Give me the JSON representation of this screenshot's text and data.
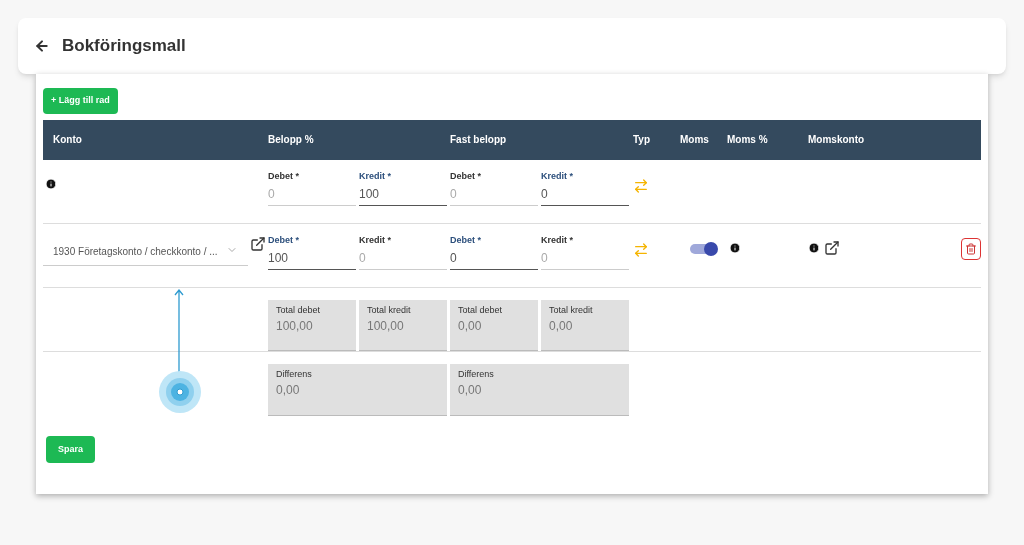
{
  "header": {
    "title": "Bokföringsmall"
  },
  "add_button": "+ Lägg till rad",
  "columns": [
    "Konto",
    "Belopp %",
    "Fast belopp",
    "Typ",
    "Moms",
    "Moms %",
    "Momskonto"
  ],
  "rows": [
    {
      "account": null,
      "belopp": [
        {
          "label": "Debet *",
          "value": "0",
          "active": false
        },
        {
          "label": "Kredit *",
          "value": "100",
          "active": true
        }
      ],
      "fast": [
        {
          "label": "Debet *",
          "value": "0",
          "active": false
        },
        {
          "label": "Kredit *",
          "value": "0",
          "active": true
        }
      ],
      "vat": null,
      "deletable": false
    },
    {
      "account": "1930 Företagskonto / checkkonto / ...",
      "belopp": [
        {
          "label": "Debet *",
          "value": "100",
          "active": true
        },
        {
          "label": "Kredit *",
          "value": "0",
          "active": false
        }
      ],
      "fast": [
        {
          "label": "Debet *",
          "value": "0",
          "active": true
        },
        {
          "label": "Kredit *",
          "value": "0",
          "active": false
        }
      ],
      "vat": {
        "on": true
      },
      "deletable": true
    }
  ],
  "totals": {
    "belopp": [
      {
        "label": "Total debet",
        "value": "100,00"
      },
      {
        "label": "Total kredit",
        "value": "100,00"
      }
    ],
    "fast": [
      {
        "label": "Total debet",
        "value": "0,00"
      },
      {
        "label": "Total kredit",
        "value": "0,00"
      }
    ]
  },
  "differens": [
    {
      "label": "Differens",
      "value": "0,00"
    },
    {
      "label": "Differens",
      "value": "0,00"
    }
  ],
  "save_button": "Spara"
}
